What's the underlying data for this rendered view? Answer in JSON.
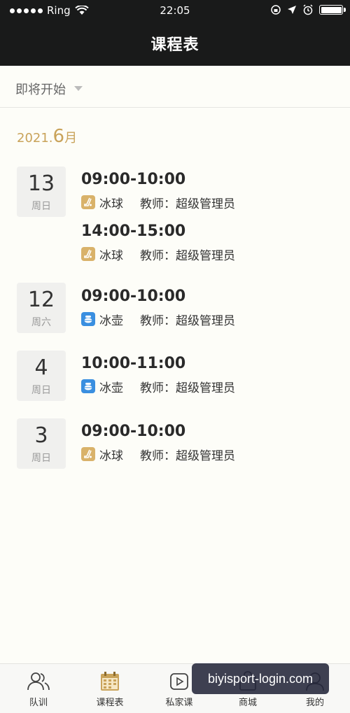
{
  "status_bar": {
    "carrier": "Ring",
    "time": "22:05"
  },
  "header": {
    "title": "课程表"
  },
  "filter": {
    "label": "即将开始"
  },
  "month": {
    "year_prefix": "2021.",
    "month_num": "6",
    "month_suffix": "月"
  },
  "days": [
    {
      "date": "13",
      "weekday": "周日",
      "slots": [
        {
          "time": "09:00-10:00",
          "sport": "冰球",
          "sport_icon": "ice-hockey-icon",
          "teacher": "教师：超级管理员"
        },
        {
          "time": "14:00-15:00",
          "sport": "冰球",
          "sport_icon": "ice-hockey-icon",
          "teacher": "教师：超级管理员"
        }
      ]
    },
    {
      "date": "12",
      "weekday": "周六",
      "slots": [
        {
          "time": "09:00-10:00",
          "sport": "冰壶",
          "sport_icon": "curling-icon",
          "teacher": "教师：超级管理员"
        }
      ]
    },
    {
      "date": "4",
      "weekday": "周日",
      "slots": [
        {
          "time": "10:00-11:00",
          "sport": "冰壶",
          "sport_icon": "curling-icon",
          "teacher": "教师：超级管理员"
        }
      ]
    },
    {
      "date": "3",
      "weekday": "周日",
      "slots": [
        {
          "time": "09:00-10:00",
          "sport": "冰球",
          "sport_icon": "ice-hockey-icon",
          "teacher": "教师：超级管理员"
        }
      ]
    }
  ],
  "tabs": [
    {
      "label": "队训",
      "icon": "team-icon"
    },
    {
      "label": "课程表",
      "icon": "calendar-icon",
      "active": true
    },
    {
      "label": "私家课",
      "icon": "video-play-icon"
    },
    {
      "label": "商城",
      "icon": "shop-icon"
    },
    {
      "label": "我的",
      "icon": "user-icon"
    }
  ],
  "watermark": "biyisport-login.com",
  "colors": {
    "header_bg": "#191a1a",
    "accent_gold": "#c9a35a",
    "hockey_icon": "#d9b26a",
    "curling_icon": "#3a8fe0"
  }
}
